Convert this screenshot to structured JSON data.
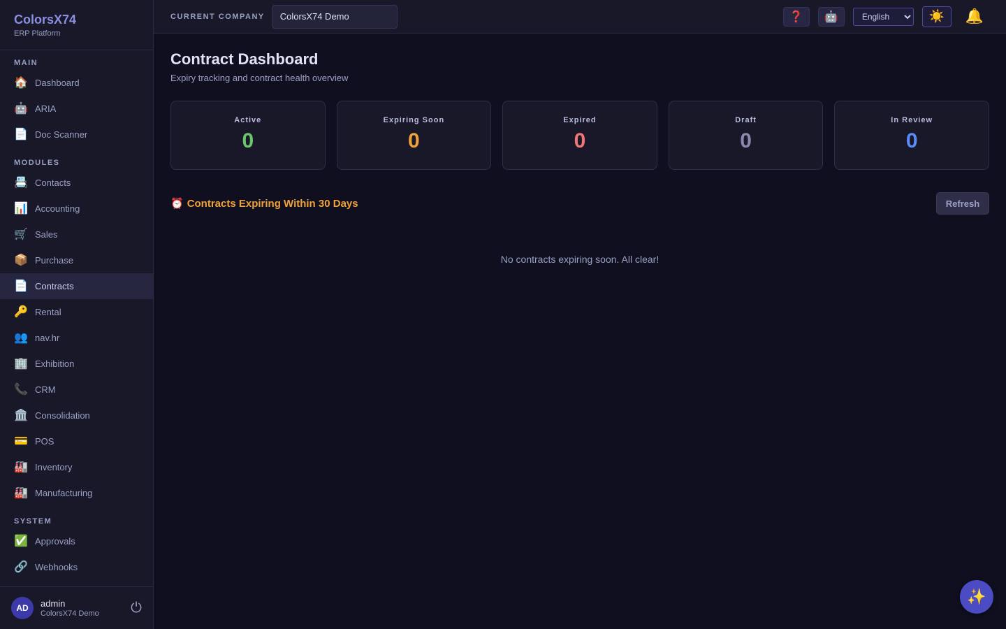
{
  "brand": {
    "name": "ColorsX74",
    "subtitle": "ERP Platform"
  },
  "sidebar": {
    "sections": [
      {
        "label": "MAIN",
        "items": [
          {
            "label": "Dashboard",
            "icon": "🏠",
            "icon_name": "house-icon"
          },
          {
            "label": "ARIA",
            "icon": "🤖",
            "icon_name": "robot-icon"
          },
          {
            "label": "Doc Scanner",
            "icon": "📄",
            "icon_name": "document-icon"
          }
        ]
      },
      {
        "label": "MODULES",
        "items": [
          {
            "label": "Contacts",
            "icon": "📇",
            "icon_name": "card-index-icon"
          },
          {
            "label": "Accounting",
            "icon": "📊",
            "icon_name": "bar-chart-icon"
          },
          {
            "label": "Sales",
            "icon": "🛒",
            "icon_name": "shopping-cart-icon"
          },
          {
            "label": "Purchase",
            "icon": "📦",
            "icon_name": "package-icon"
          },
          {
            "label": "Contracts",
            "icon": "📄",
            "icon_name": "document-icon",
            "active": true
          },
          {
            "label": "Rental",
            "icon": "🔑",
            "icon_name": "key-icon"
          },
          {
            "label": "nav.hr",
            "icon": "👥",
            "icon_name": "people-icon"
          },
          {
            "label": "Exhibition",
            "icon": "🏢",
            "icon_name": "office-building-icon"
          },
          {
            "label": "CRM",
            "icon": "📞",
            "icon_name": "phone-icon"
          },
          {
            "label": "Consolidation",
            "icon": "🏛️",
            "icon_name": "classical-building-icon"
          },
          {
            "label": "POS",
            "icon": "💳",
            "icon_name": "credit-card-icon"
          },
          {
            "label": "Inventory",
            "icon": "🏭",
            "icon_name": "factory-icon"
          },
          {
            "label": "Manufacturing",
            "icon": "🏭",
            "icon_name": "factory-icon"
          }
        ]
      },
      {
        "label": "SYSTEM",
        "items": [
          {
            "label": "Approvals",
            "icon": "✅",
            "icon_name": "check-mark-icon"
          },
          {
            "label": "Webhooks",
            "icon": "🔗",
            "icon_name": "link-icon"
          }
        ]
      }
    ]
  },
  "user": {
    "initials": "AD",
    "name": "admin",
    "company": "ColorsX74 Demo",
    "power_icon": "⏻"
  },
  "topbar": {
    "company_label": "CURRENT COMPANY",
    "company_value": "ColorsX74 Demo",
    "help_icon": "❓",
    "bot_icon": "🤖",
    "language": "English",
    "theme_icon": "☀️",
    "bell_icon": "🔔"
  },
  "page": {
    "title": "Contract Dashboard",
    "subtitle": "Expiry tracking and contract health overview"
  },
  "stats": [
    {
      "label": "Active",
      "value": "0",
      "color": "#6cc76c"
    },
    {
      "label": "Expiring Soon",
      "value": "0",
      "color": "#f0a23a"
    },
    {
      "label": "Expired",
      "value": "0",
      "color": "#f07575"
    },
    {
      "label": "Draft",
      "value": "0",
      "color": "#8a8aae"
    },
    {
      "label": "In Review",
      "value": "0",
      "color": "#5b8cf5"
    }
  ],
  "expiring": {
    "icon": "⏰",
    "title": "Contracts Expiring Within 30 Days",
    "refresh_label": "Refresh",
    "empty_message": "No contracts expiring soon. All clear!"
  },
  "fab": {
    "icon": "✨"
  }
}
